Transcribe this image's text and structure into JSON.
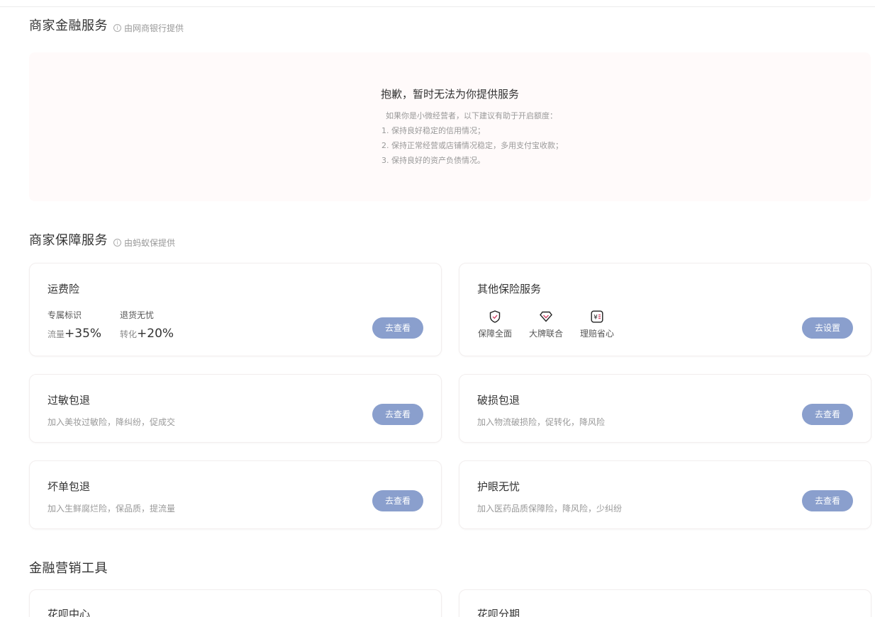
{
  "finance": {
    "title": "商家金融服务",
    "provider": "由网商银行提供",
    "empty_title": "抱歉，暂时无法为你提供服务",
    "tips": [
      "如果你是小微经营者，以下建议有助于开启额度：",
      "1. 保持良好稳定的信用情况；",
      "2. 保持正常经营或店铺情况稳定，多用支付宝收款；",
      "3. 保持良好的资产负债情况。"
    ]
  },
  "protection": {
    "title": "商家保障服务",
    "provider": "由蚂蚁保提供",
    "freight": {
      "name": "运费险",
      "stats": [
        {
          "key": "专属标识",
          "unit": "流量",
          "value": "+35%"
        },
        {
          "key": "退货无忧",
          "unit": "转化",
          "value": "+20%"
        }
      ],
      "button": "去查看"
    },
    "other": {
      "name": "其他保险服务",
      "features": [
        {
          "label": "保障全面",
          "icon": "shield-check-icon"
        },
        {
          "label": "大牌联合",
          "icon": "diamond-icon"
        },
        {
          "label": "理赔省心",
          "icon": "yuan-receipt-icon"
        }
      ],
      "button": "去设置"
    },
    "items": [
      {
        "name": "过敏包退",
        "desc": "加入美妆过敏险，降纠纷，促成交",
        "button": "去查看"
      },
      {
        "name": "破损包退",
        "desc": "加入物流破损险，促转化，降风险",
        "button": "去查看"
      },
      {
        "name": "坏单包退",
        "desc": "加入生鲜腐烂险，保品质，提流量",
        "button": "去查看"
      },
      {
        "name": "护眼无忧",
        "desc": "加入医药品质保障险，降风险，少纠纷",
        "button": "去查看"
      }
    ]
  },
  "marketing": {
    "title": "金融营销工具",
    "cards": [
      {
        "name": "花呗中心"
      },
      {
        "name": "花呗分期"
      }
    ]
  },
  "colors": {
    "button": "#8a9fcd",
    "panel_bg": "#fffafa",
    "icon_accent": "#d4476a"
  }
}
